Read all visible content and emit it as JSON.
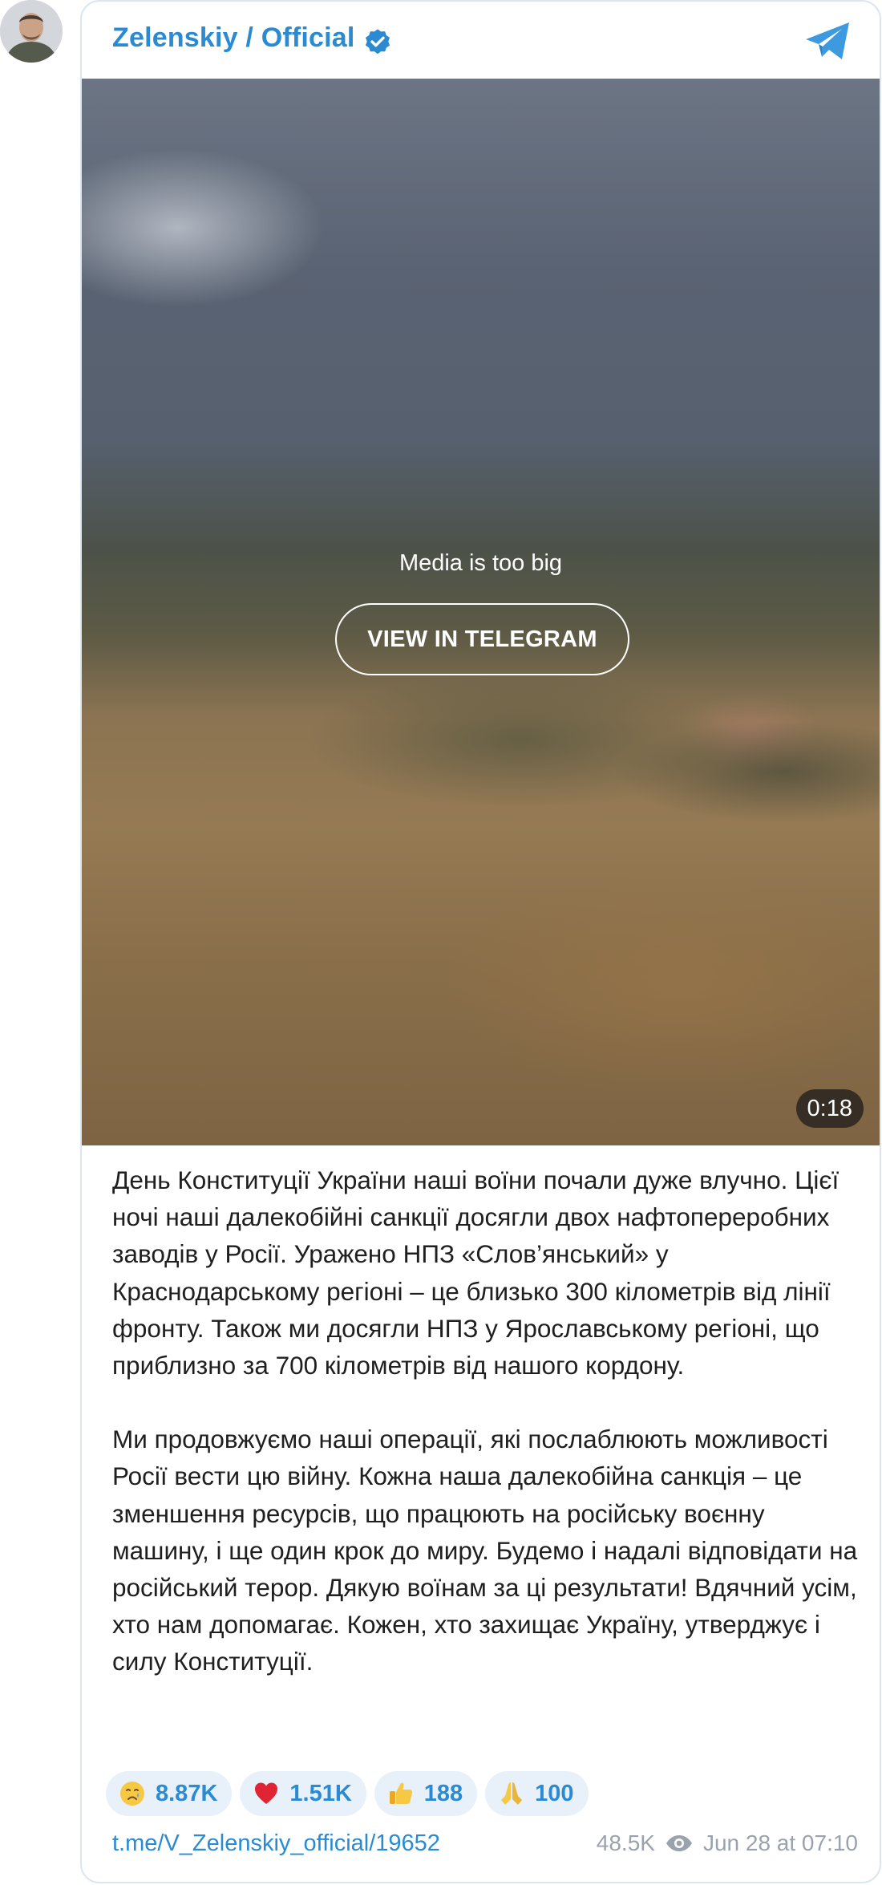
{
  "channel": {
    "name": "Zelenskiy / Official",
    "verified_icon": "verified-badge-icon",
    "platform_icon": "telegram-icon",
    "accent_color": "#2a8ad2"
  },
  "media": {
    "message": "Media is too big",
    "button_label": "VIEW IN TELEGRAM",
    "duration": "0:18"
  },
  "post": {
    "paragraphs": [
      "День Конституції України наші воїни почали дуже влучно. Цієї ночі наші далекобійні санкції досягли двох нафтопереробних заводів у Росії. Уражено НПЗ «Слов’янський» у Краснодарському регіоні – це близько 300 кілометрів від лінії фронту. Також ми досягли НПЗ у Ярославському регіоні, що приблизно за 700 кілометрів від нашого кордону.",
      "Ми продовжуємо наші операції, які послаблюють можливості Росії вести цю війну. Кожна наша далекобійна санкція – це зменшення ресурсів, що працюють на російську воєнну машину, і ще один крок до миру. Будемо і надалі відповідати на російський терор. Дякую воїнам за ці результати! Вдячний усім, хто нам допомагає. Кожен, хто захищає Україну, утверджує і силу Конституції."
    ]
  },
  "reactions": [
    {
      "emoji": "crying-face-icon",
      "count": "8.87K"
    },
    {
      "emoji": "red-heart-icon",
      "count": "1.51K"
    },
    {
      "emoji": "thumbs-up-icon",
      "count": "188"
    },
    {
      "emoji": "folded-hands-icon",
      "count": "100"
    }
  ],
  "footer": {
    "link": "t.me/V_Zelenskiy_official/19652",
    "views": "48.5K",
    "views_icon": "eye-icon",
    "date": "Jun 28 at 07:10"
  }
}
